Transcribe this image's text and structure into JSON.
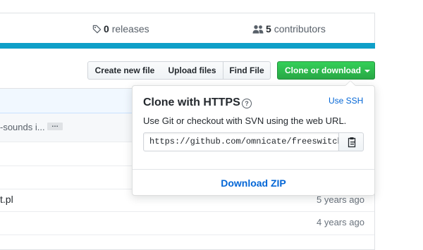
{
  "summary": {
    "releases": {
      "count": "0",
      "label": "releases"
    },
    "contributors": {
      "count": "5",
      "label": "contributors"
    }
  },
  "toolbar": {
    "create_new_file": "Create new file",
    "upload_files": "Upload files",
    "find_file": "Find File",
    "clone_or_download": "Clone or download"
  },
  "files": {
    "commit_message_fragment": "-sounds i...",
    "ellipsis": "…",
    "rows": [
      {
        "name": "",
        "age": ""
      },
      {
        "name": "",
        "age": ""
      },
      {
        "name": "t.pl",
        "age": "5 years ago"
      },
      {
        "name": "",
        "age": "4 years ago"
      }
    ]
  },
  "clone_popover": {
    "title": "Clone with HTTPS",
    "use_ssh": "Use SSH",
    "description": "Use Git or checkout with SVN using the web URL.",
    "url": "https://github.com/omnicate/freeswitch.git",
    "download_zip": "Download ZIP"
  },
  "colors": {
    "accent_blue": "#0366d6",
    "clone_button_green": "#28a745",
    "language_bar": "#0f9fc8"
  }
}
